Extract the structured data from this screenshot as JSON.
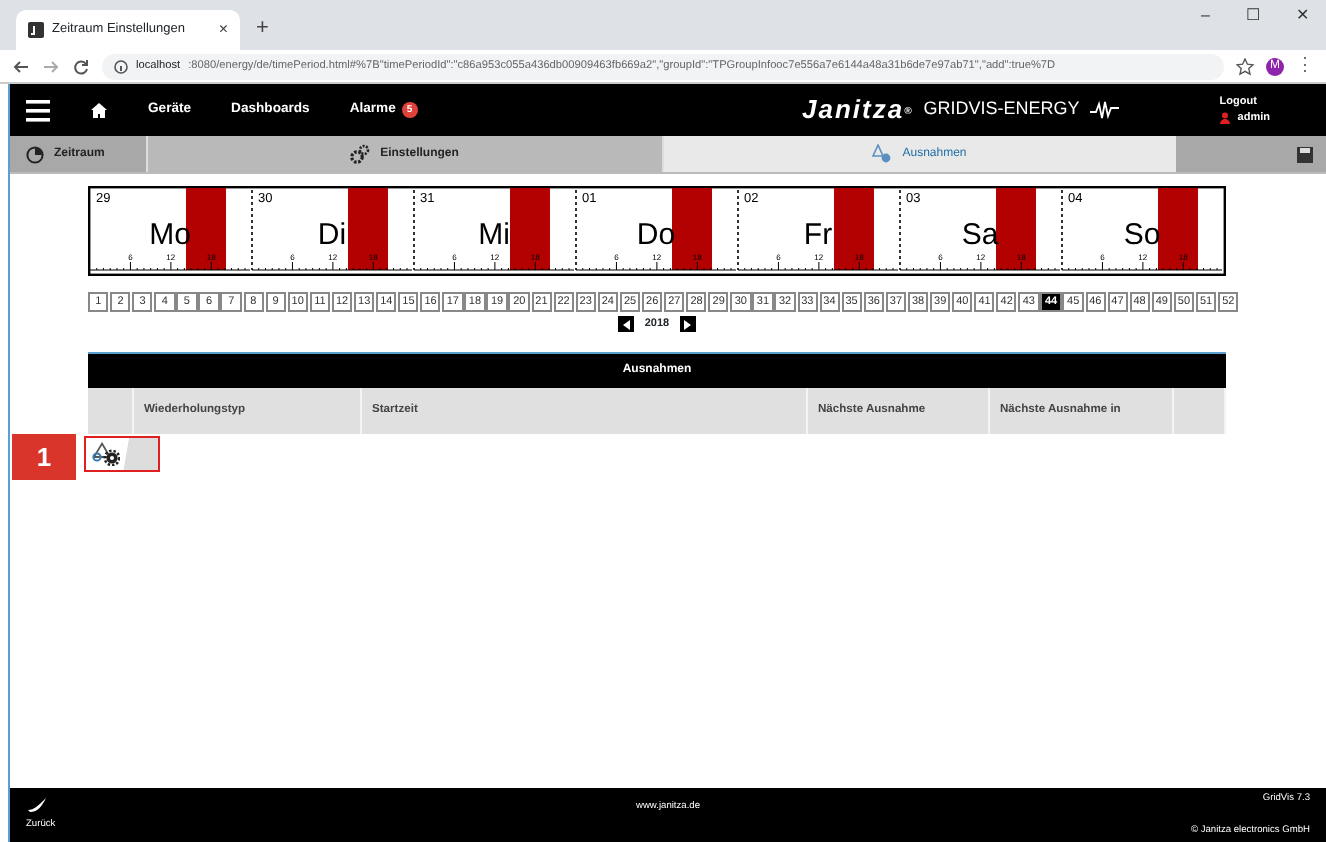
{
  "browser": {
    "tab_title": "Zeitraum Einstellungen",
    "tab_close": "×",
    "new_tab": "+",
    "window_controls": [
      "–",
      "☐",
      "✕"
    ],
    "url_host": "localhost",
    "url_rest": ":8080/energy/de/timePeriod.html#%7B\"timePeriodId\":\"c86a953c055a436db00909463fb669a2\",\"groupId\":\"TPGroupInfooc7e556a7e6144a48a31b6de7e97ab71\",\"add\":true%7D",
    "avatar": "M",
    "menu": "⋮"
  },
  "navbar": {
    "items": [
      {
        "label": "Geräte"
      },
      {
        "label": "Dashboards"
      },
      {
        "label": "Alarme",
        "badge": "5"
      }
    ],
    "logo": "Janitza",
    "logo_mark": "®",
    "product": "GRIDVIS-ENERGY",
    "logout": "Logout",
    "user": "admin"
  },
  "subtabs": [
    {
      "kind": "side",
      "label": "Zeitraum",
      "selected": false
    },
    {
      "kind": "main",
      "label": "Einstellungen",
      "selected": false
    },
    {
      "kind": "main",
      "label": "Ausnahmen",
      "selected": true
    },
    {
      "kind": "save",
      "selected": false
    }
  ],
  "timeline": {
    "days": [
      {
        "date": "29",
        "name": "Mo",
        "ticks": [
          "6",
          "12",
          "18"
        ]
      },
      {
        "date": "30",
        "name": "Di",
        "ticks": [
          "6",
          "12",
          "18"
        ]
      },
      {
        "date": "31",
        "name": "Mi",
        "ticks": [
          "6",
          "12",
          "18"
        ]
      },
      {
        "date": "01",
        "name": "Do",
        "ticks": [
          "6",
          "12",
          "18"
        ]
      },
      {
        "date": "02",
        "name": "Fr",
        "ticks": [
          "6",
          "12",
          "18"
        ]
      },
      {
        "date": "03",
        "name": "Sa",
        "ticks": [
          "6",
          "12",
          "18"
        ]
      },
      {
        "date": "04",
        "name": "So",
        "ticks": [
          "6",
          "12",
          "18"
        ]
      }
    ]
  },
  "weeks": {
    "items": [
      {
        "label": "1",
        "selected": false
      },
      {
        "label": "2",
        "selected": false
      },
      {
        "label": "3",
        "selected": false
      },
      {
        "label": "4",
        "selected": false
      },
      {
        "label": "5",
        "selected": false
      },
      {
        "label": "6",
        "selected": false
      },
      {
        "label": "7",
        "selected": false
      },
      {
        "label": "8",
        "selected": false
      },
      {
        "label": "9",
        "selected": false
      },
      {
        "label": "10",
        "selected": false
      },
      {
        "label": "11",
        "selected": false
      },
      {
        "label": "12",
        "selected": false
      },
      {
        "label": "13",
        "selected": false
      },
      {
        "label": "14",
        "selected": false
      },
      {
        "label": "15",
        "selected": false
      },
      {
        "label": "16",
        "selected": false
      },
      {
        "label": "17",
        "selected": false
      },
      {
        "label": "18",
        "selected": false
      },
      {
        "label": "19",
        "selected": false
      },
      {
        "label": "20",
        "selected": false
      },
      {
        "label": "21",
        "selected": false
      },
      {
        "label": "22",
        "selected": false
      },
      {
        "label": "23",
        "selected": false
      },
      {
        "label": "24",
        "selected": false
      },
      {
        "label": "25",
        "selected": false
      },
      {
        "label": "26",
        "selected": false
      },
      {
        "label": "27",
        "selected": false
      },
      {
        "label": "28",
        "selected": false
      },
      {
        "label": "29",
        "selected": false
      },
      {
        "label": "30",
        "selected": false
      },
      {
        "label": "31",
        "selected": false
      },
      {
        "label": "32",
        "selected": false
      },
      {
        "label": "33",
        "selected": false
      },
      {
        "label": "34",
        "selected": false
      },
      {
        "label": "35",
        "selected": false
      },
      {
        "label": "36",
        "selected": false
      },
      {
        "label": "37",
        "selected": false
      },
      {
        "label": "38",
        "selected": false
      },
      {
        "label": "39",
        "selected": false
      },
      {
        "label": "40",
        "selected": false
      },
      {
        "label": "41",
        "selected": false
      },
      {
        "label": "42",
        "selected": false
      },
      {
        "label": "43",
        "selected": false
      },
      {
        "label": "44",
        "selected": true
      },
      {
        "label": "45",
        "selected": false
      },
      {
        "label": "46",
        "selected": false
      },
      {
        "label": "47",
        "selected": false
      },
      {
        "label": "48",
        "selected": false
      },
      {
        "label": "49",
        "selected": false
      },
      {
        "label": "50",
        "selected": false
      },
      {
        "label": "51",
        "selected": false
      },
      {
        "label": "52",
        "selected": false
      }
    ],
    "year": "2018"
  },
  "table": {
    "title": "Ausnahmen",
    "columns": [
      "",
      "Wiederholungstyp",
      "Startzeit",
      "Nächste Ausnahme",
      "Nächste Ausnahme in",
      ""
    ]
  },
  "step_marker": "1",
  "footer": {
    "back": "Zurück",
    "site": "www.janitza.de",
    "version": "GridVis 7.3",
    "copyright": "© Janitza electronics GmbH"
  }
}
